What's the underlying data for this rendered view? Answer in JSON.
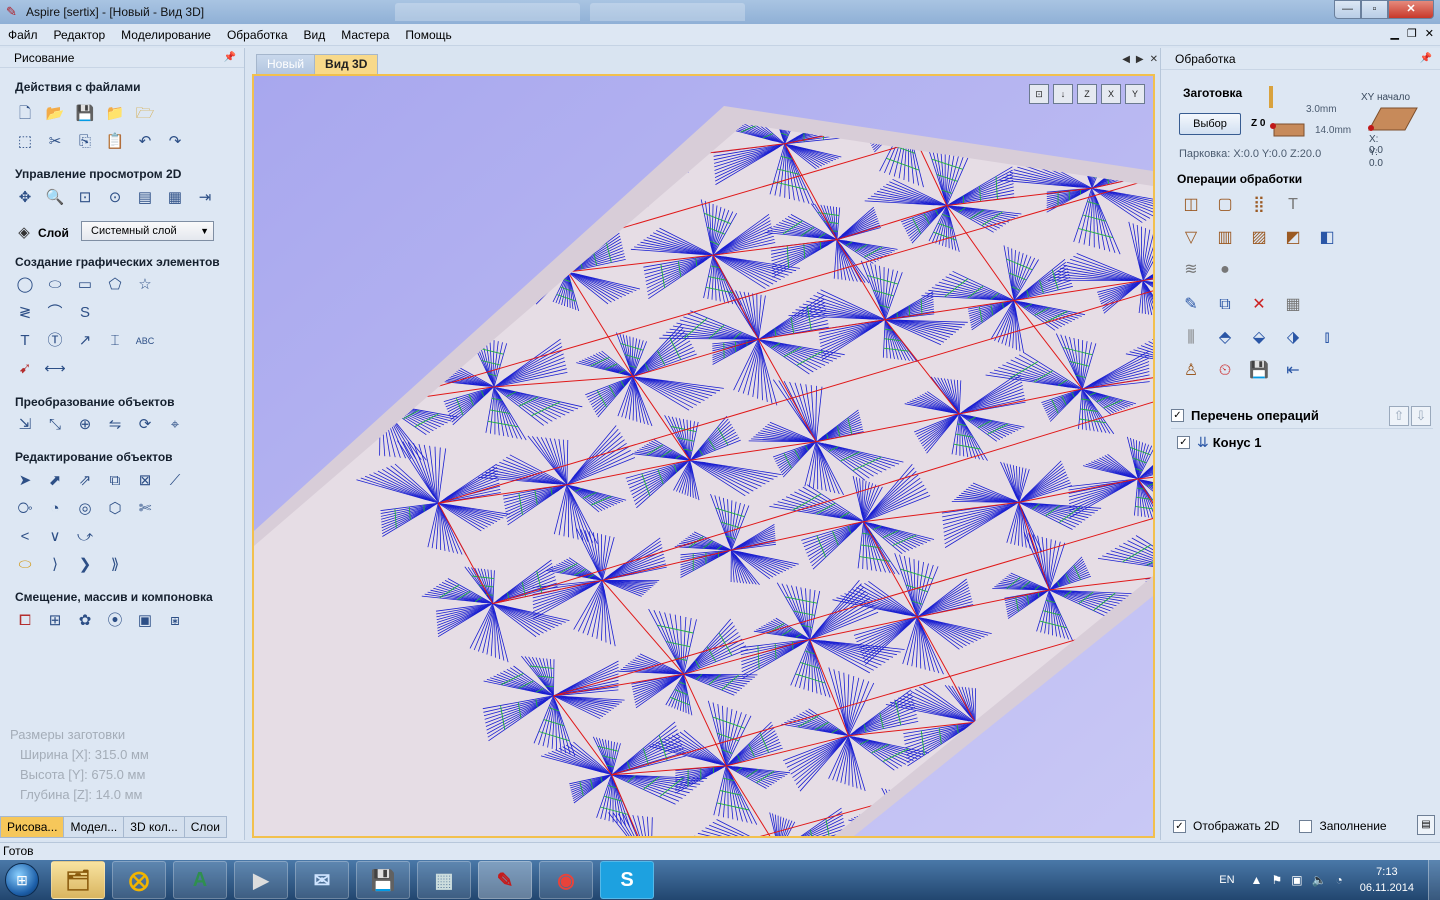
{
  "window": {
    "title": "Aspire [sertix] - [Новый - Вид 3D]",
    "controls": {
      "minimize": "—",
      "maximize": "▫",
      "close": "✕"
    }
  },
  "menu": [
    "Файл",
    "Редактор",
    "Моделирование",
    "Обработка",
    "Вид",
    "Мастера",
    "Помощь"
  ],
  "left_panel": {
    "title": "Рисование",
    "sections": {
      "file": "Действия с файлами",
      "view2d": "Управление просмотром 2D",
      "create": "Создание графических элементов",
      "transform": "Преобразование объектов",
      "edit": "Редактирование объектов",
      "offset": "Смещение, массив и компоновка"
    },
    "layer_label": "Слой",
    "layer_value": "Системный слой",
    "stock": {
      "title": "Размеры заготовки",
      "width": "Ширина  [X]: 315.0 мм",
      "height": "Высота  [Y]: 675.0 мм",
      "depth": "Глубина [Z]: 14.0 мм"
    },
    "tabs": [
      "Рисова...",
      "Модел...",
      "3D кол...",
      "Слои"
    ]
  },
  "document_tabs": [
    "Новый",
    "Вид 3D"
  ],
  "viewport": {
    "view_buttons": [
      "⊡",
      "↓",
      "Z",
      "X",
      "Y"
    ]
  },
  "right_panel": {
    "title": "Обработка",
    "stock_title": "Заготовка",
    "select_button": "Выбор",
    "z_label": "Z 0",
    "thickness_top": "3.0mm",
    "thickness_total": "14.0mm",
    "xy_title": "XY начало",
    "xy_x": "X: 0.0",
    "xy_y": "Y: 0.0",
    "parking": "Парковка:  X:0.0 Y:0.0 Z:20.0",
    "ops_title": "Операции обработки",
    "ops_list_title": "Перечень операций",
    "operation_1": "Конус 1",
    "show2d": "Отображать 2D",
    "fill": "Заполнение"
  },
  "status": "Готов",
  "taskbar": {
    "lang": "EN",
    "time": "7:13",
    "date": "06.11.2014"
  },
  "colors": {
    "accent_tab": "#f6c75a",
    "toolpath_blue": "#1a1fd1",
    "toolpath_red": "#e01818",
    "toolpath_green": "#20b040",
    "stock_surface": "#e6dde5"
  }
}
